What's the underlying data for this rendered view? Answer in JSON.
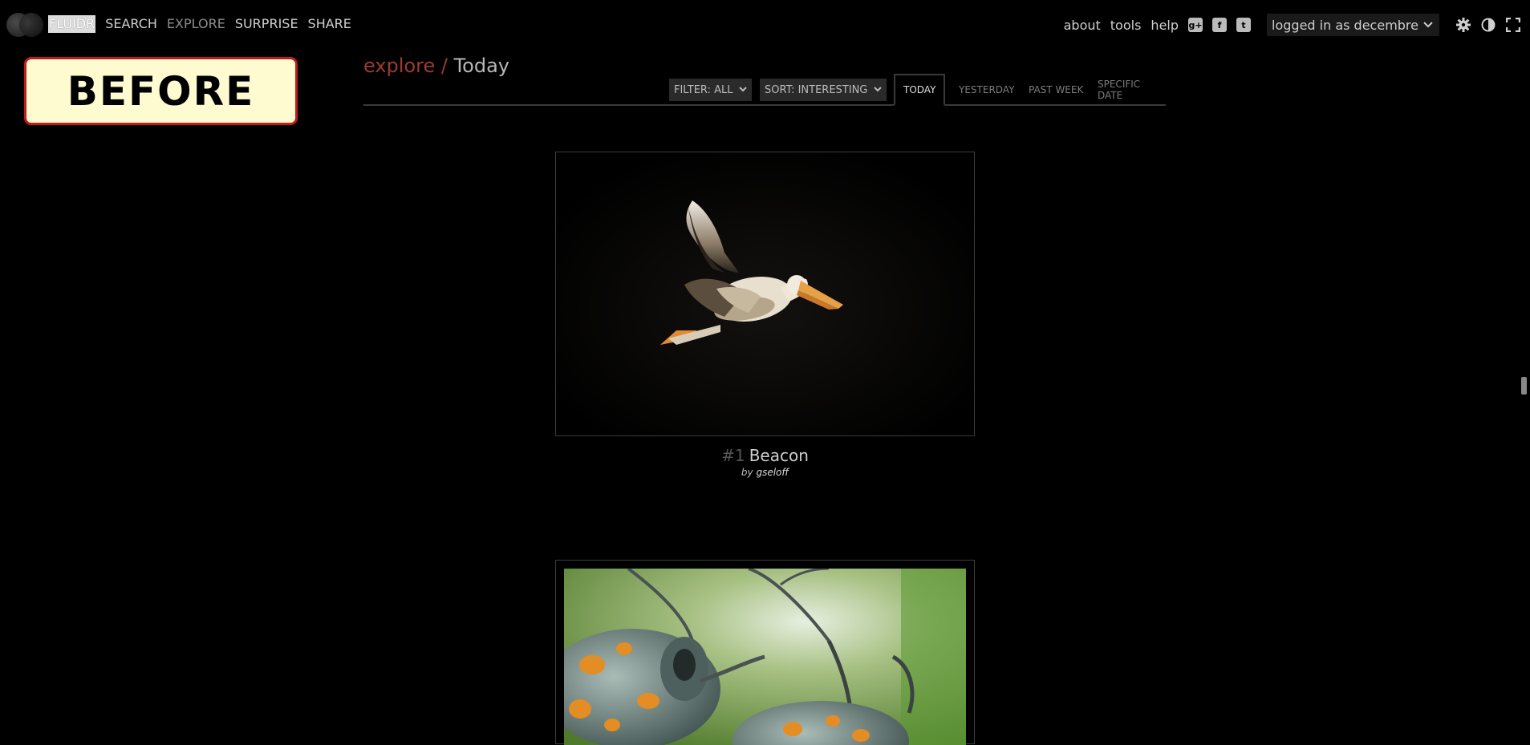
{
  "nav": {
    "brand": "FLUIDR",
    "items": [
      "SEARCH",
      "EXPLORE",
      "SURPRISE",
      "SHARE"
    ]
  },
  "top_right": {
    "links": [
      "about",
      "tools",
      "help"
    ],
    "social_icons": [
      "google-plus-icon",
      "facebook-icon",
      "twitter-icon"
    ],
    "user_label": "logged in as decembre",
    "tool_icons": [
      "gear-icon",
      "contrast-icon",
      "fullscreen-icon"
    ]
  },
  "overlay_label": "BEFORE",
  "heading": {
    "crumb": "explore /",
    "title": "Today"
  },
  "controls": {
    "filter": "FILTER: ALL",
    "sort": "SORT: INTERESTING",
    "tabs": [
      "TODAY",
      "YESTERDAY",
      "PAST WEEK",
      "SPECIFIC DATE"
    ],
    "active_tab": "TODAY"
  },
  "photos": [
    {
      "rank": "#1",
      "title": "Beacon",
      "by_prefix": "by",
      "user": "gseloff"
    }
  ],
  "colors": {
    "background": "#000000",
    "crumb": "#9b3b30",
    "label_bg": "#fefbd0",
    "label_border": "#c21b1b"
  }
}
